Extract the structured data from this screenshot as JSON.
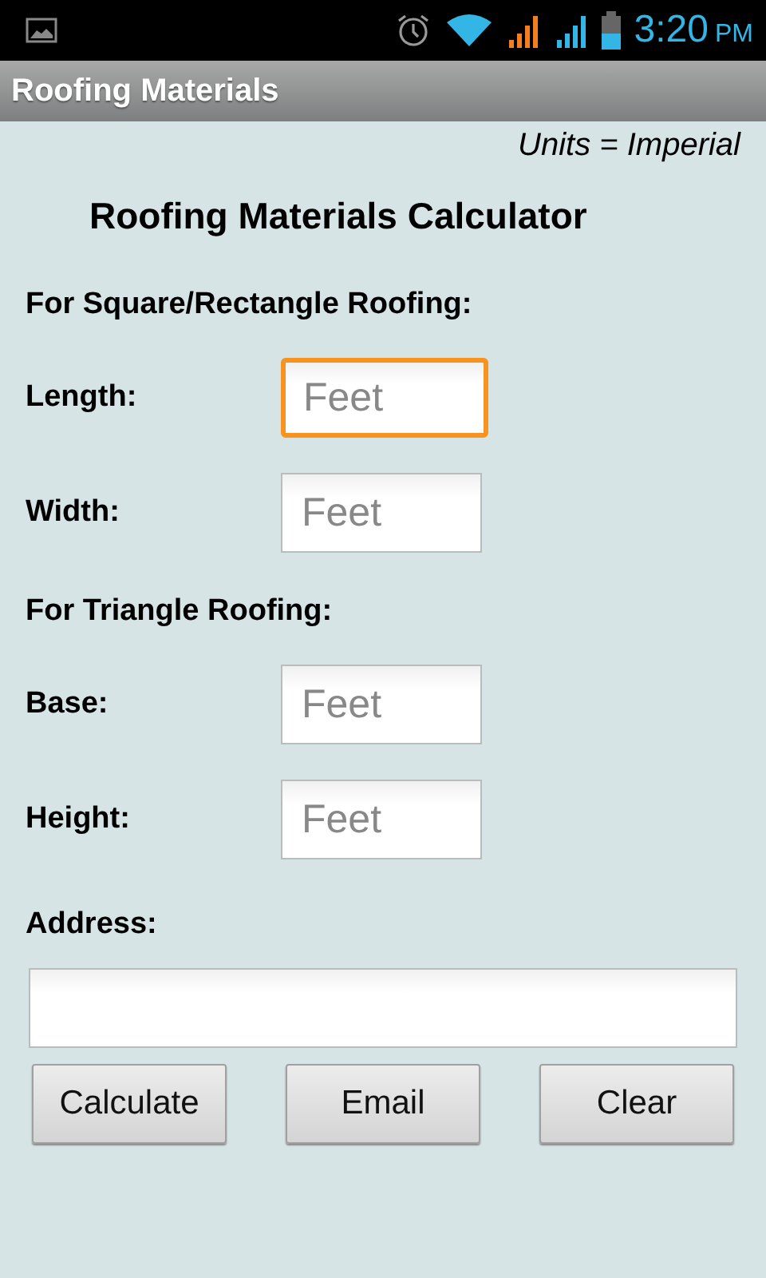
{
  "status_bar": {
    "time": "3:20",
    "ampm": "PM"
  },
  "window": {
    "title": "Roofing Materials"
  },
  "units": "Units = Imperial",
  "heading": "Roofing Materials Calculator",
  "sections": [
    {
      "title": "For Square/Rectangle Roofing:",
      "fields": [
        {
          "label": "Length:",
          "placeholder": "Feet",
          "focused": true
        },
        {
          "label": "Width:",
          "placeholder": "Feet",
          "focused": false
        }
      ]
    },
    {
      "title": "For Triangle Roofing:",
      "fields": [
        {
          "label": "Base:",
          "placeholder": "Feet",
          "focused": false
        },
        {
          "label": "Height:",
          "placeholder": "Feet",
          "focused": false
        }
      ]
    }
  ],
  "address": {
    "label": "Address:",
    "focused": false
  },
  "buttons": [
    "Calculate",
    "Email",
    "Clear"
  ]
}
